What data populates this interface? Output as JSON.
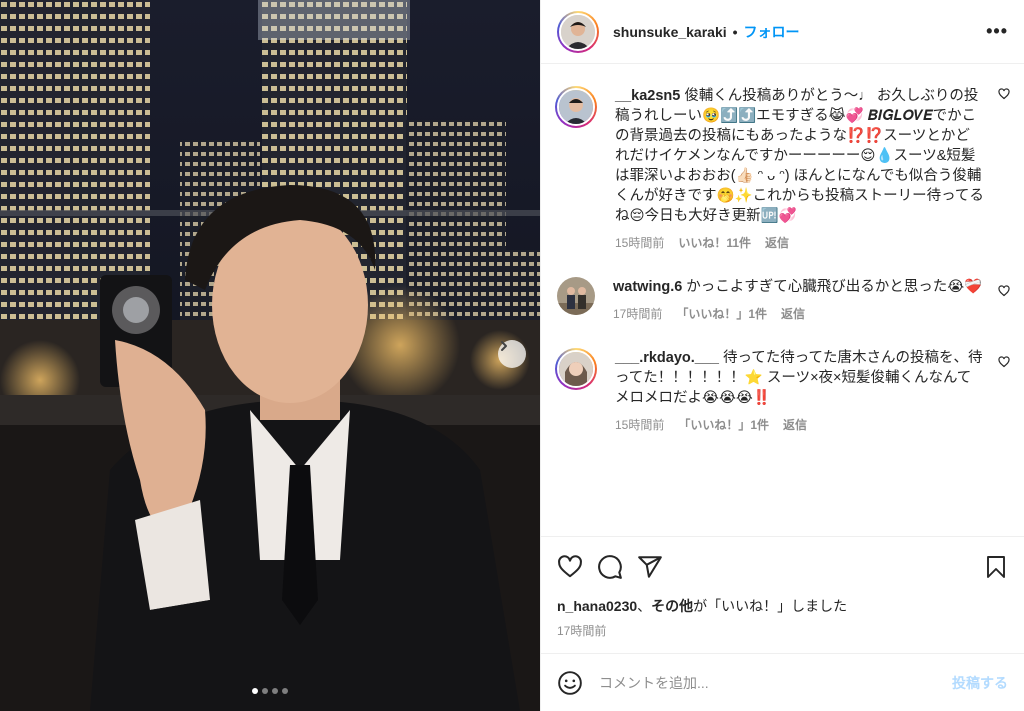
{
  "header": {
    "username": "shunsuke_karaki",
    "separator": "•",
    "follow_label": "フォロー",
    "more_label": "•••"
  },
  "comments": [
    {
      "username": "__ka2sn5",
      "text": "俊輔くん投稿ありがとう～♩ お久しぶりの投稿うれしーい🥹⤴️⤴️エモすぎる😹💞 𝑩𝑰𝑮𝑳𝑶𝑽𝑬でかこの背景過去の投稿にもあったような⁉️⁉️スーツとかどれだけイケメンなんですかーーーーー😌💧スーツ&短髪は罪深いよおおお(👍🏻 ᵔ ᴗ ᵔ) ほんとになんでも似合う俊輔くんが好きです🤭✨これからも投稿ストーリー待ってるね😔今日も大好き更新🆙💞",
      "time": "15時間前",
      "likes": "いいね！11件",
      "reply": "返信"
    },
    {
      "username": "watwing.6",
      "text": "かっこよすぎて心臓飛び出るかと思った😭❤️‍🩹",
      "time": "17時間前",
      "likes": "「いいね！」1件",
      "reply": "返信"
    },
    {
      "username": "___.rkdayo.___",
      "text": "待ってた待ってた唐木さんの投稿を、待ってた！！！！！！⭐️ スーツ×夜×短髪俊輔くんなんてメロメロだよ😭😭😭‼️",
      "time": "15時間前",
      "likes": "「いいね！」1件",
      "reply": "返信"
    }
  ],
  "likes_line": {
    "user": "n_hana0230",
    "joiner": "、",
    "others": "その他",
    "suffix": "が「いいね！」しました"
  },
  "post_time": "17時間前",
  "composer": {
    "placeholder": "コメントを追加...",
    "post_label": "投稿する"
  },
  "carousel": {
    "count": 4,
    "active": 0
  }
}
